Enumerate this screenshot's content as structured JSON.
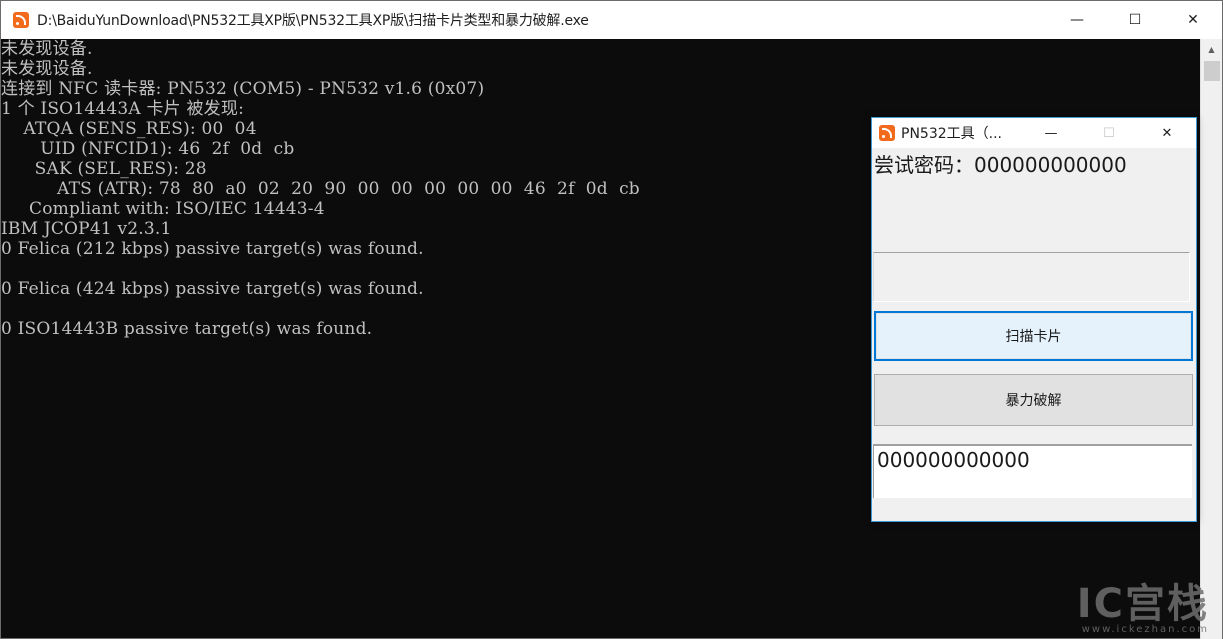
{
  "console": {
    "title": "D:\\BaiduYunDownload\\PN532工具XP版\\PN532工具XP版\\扫描卡片类型和暴力破解.exe",
    "lines": [
      "未发现设备.",
      "未发现设备.",
      "连接到 NFC 读卡器: PN532 (COM5) - PN532 v1.6 (0x07)",
      "1 个 ISO14443A 卡片 被发现:",
      "    ATQA (SENS_RES): 00  04",
      "       UID (NFCID1): 46  2f  0d  cb",
      "      SAK (SEL_RES): 28",
      "          ATS (ATR): 78  80  a0  02  20  90  00  00  00  00  00  46  2f  0d  cb",
      "     Compliant with: ISO/IEC 14443-4",
      "IBM JCOP41 v2.3.1",
      "0 Felica (212 kbps) passive target(s) was found.",
      "",
      "0 Felica (424 kbps) passive target(s) was found.",
      "",
      "0 ISO14443B passive target(s) was found."
    ],
    "controls": {
      "minimize": "—",
      "maximize": "☐",
      "close": "✕"
    }
  },
  "tool": {
    "title": "PN532工具（...",
    "password_label": "尝试密码：",
    "password_value": "000000000000",
    "scan_button": "扫描卡片",
    "brute_button": "暴力破解",
    "result_value": "000000000000",
    "controls": {
      "minimize": "—",
      "maximize": "☐",
      "close": "✕"
    }
  },
  "watermark": {
    "logo": "IC宫栈",
    "url": "www.ickezhan.com"
  },
  "colors": {
    "console_bg": "#0c0c0c",
    "console_text": "#c0c0c0",
    "accent": "#0078d7",
    "icon": "#f26a1b"
  },
  "icons": {
    "app": "rss-feed-icon"
  }
}
